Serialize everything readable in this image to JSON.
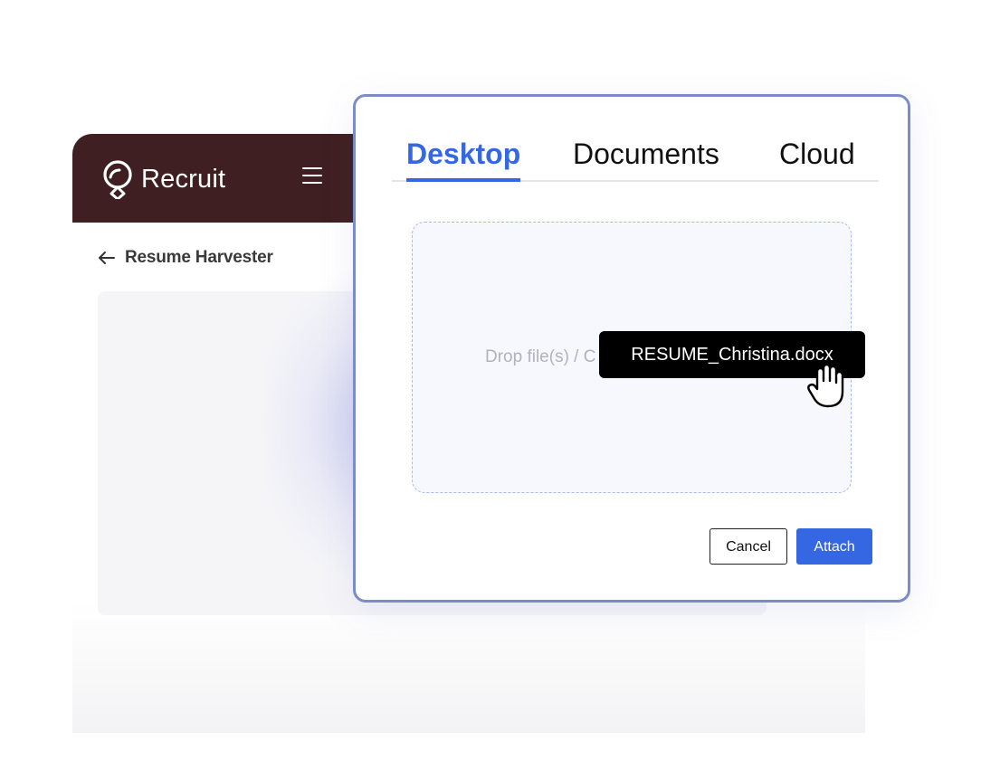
{
  "app": {
    "brand": "Recruit",
    "page_title": "Resume Harvester",
    "header_color": "#3f1f21"
  },
  "dialog": {
    "tabs": [
      {
        "label": "Desktop",
        "active": true
      },
      {
        "label": "Documents",
        "active": false
      },
      {
        "label": "Cloud",
        "active": false
      }
    ],
    "dropzone_text": "Drop file(s) / C",
    "dragged_file": "RESUME_Christina.docx",
    "buttons": {
      "cancel": "Cancel",
      "attach": "Attach"
    },
    "accent_color": "#3567e3",
    "border_color": "#7b8cc9"
  },
  "icons": {
    "logo": "recruit-logo-icon",
    "menu": "hamburger-menu-icon",
    "back": "back-arrow-icon",
    "cursor": "grab-hand-cursor-icon"
  }
}
